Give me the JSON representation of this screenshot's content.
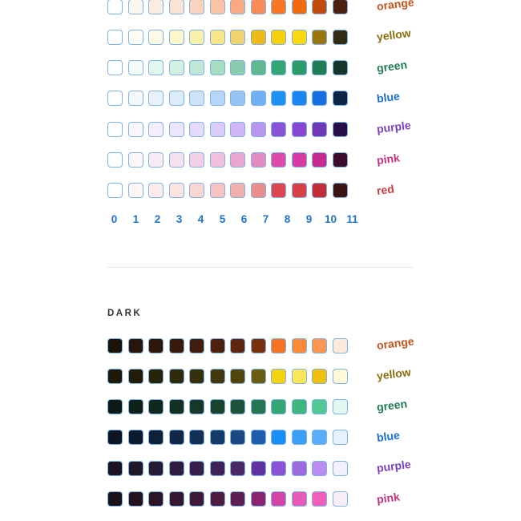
{
  "light": {
    "rows": [
      {
        "label": "orange",
        "label_color": "#c2561d",
        "swatches": [
          "#ffffff",
          "#fcf6f1",
          "#fbede2",
          "#fbe3d3",
          "#fbd4be",
          "#fbc3a3",
          "#fba982",
          "#f98c58",
          "#f87522",
          "#f26a10",
          "#c04c0c",
          "#4b200e"
        ]
      },
      {
        "label": "yellow",
        "label_color": "#8c6d0f",
        "swatches": [
          "#ffffff",
          "#fefdf4",
          "#fdfae3",
          "#fcf6c9",
          "#fbf0aa",
          "#f9e58a",
          "#f1d370",
          "#eeba16",
          "#f6d00f",
          "#fbd70f",
          "#9a760f",
          "#302b12"
        ]
      },
      {
        "label": "green",
        "label_color": "#1f7a4f",
        "swatches": [
          "#ffffff",
          "#f4fbf8",
          "#e3f6ee",
          "#d3f0e3",
          "#bfe7d5",
          "#a5dcc2",
          "#8ccbaf",
          "#5fb890",
          "#34a673",
          "#2b9b6a",
          "#207c55",
          "#143629"
        ]
      },
      {
        "label": "blue",
        "label_color": "#1a6fd4",
        "swatches": [
          "#ffffff",
          "#f4f8fd",
          "#e8f1fc",
          "#ddecfb",
          "#cce3fa",
          "#b5d6f8",
          "#95c4f5",
          "#6eb0f2",
          "#1f8ff3",
          "#1a86f2",
          "#176fe1",
          "#0c2445"
        ]
      },
      {
        "label": "purple",
        "label_color": "#7a3fbf",
        "swatches": [
          "#ffffff",
          "#f9f7fd",
          "#f2eefd",
          "#ede5fc",
          "#e5dafb",
          "#dbcbf8",
          "#cfb6f5",
          "#b995ee",
          "#8a52d4",
          "#8847d0",
          "#7038b6",
          "#280f4a"
        ]
      },
      {
        "label": "pink",
        "label_color": "#c0307d",
        "swatches": [
          "#ffffff",
          "#fcf5fa",
          "#f9ebf4",
          "#f6e0ee",
          "#f3d0e6",
          "#f0c1dd",
          "#eba6d0",
          "#e48ac2",
          "#dd4aa8",
          "#d73aa0",
          "#c62a8c",
          "#3d0c2c"
        ]
      },
      {
        "label": "red",
        "label_color": "#c93a40",
        "swatches": [
          "#ffffff",
          "#fdf6f5",
          "#fbeceb",
          "#fae4e2",
          "#f8d6d4",
          "#f5c4c2",
          "#f0aeac",
          "#ea8e8d",
          "#db4650",
          "#d84048",
          "#c32d36",
          "#3b1513"
        ]
      }
    ],
    "indices": [
      "0",
      "1",
      "2",
      "3",
      "4",
      "5",
      "6",
      "7",
      "8",
      "9",
      "10",
      "11"
    ]
  },
  "dark": {
    "title": "DARK",
    "rows": [
      {
        "label": "orange",
        "label_color": "#c2561d",
        "swatches": [
          "#1e1309",
          "#28150b",
          "#30170b",
          "#38190b",
          "#421c0d",
          "#4f200e",
          "#5e250f",
          "#7b310f",
          "#f57222",
          "#fb8a3b",
          "#fb9651",
          "#fbe9dc"
        ]
      },
      {
        "label": "yellow",
        "label_color": "#8c6d0f",
        "swatches": [
          "#1b1908",
          "#211d09",
          "#282409",
          "#2f2a0b",
          "#35300b",
          "#42380c",
          "#52440d",
          "#6b5d10",
          "#f5d20f",
          "#fbe85a",
          "#f0c00f",
          "#fdf8d8"
        ]
      },
      {
        "label": "green",
        "label_color": "#1f7a4f",
        "swatches": [
          "#0b1a14",
          "#0f2019",
          "#11281e",
          "#133023",
          "#163829",
          "#1a4331",
          "#1f523b",
          "#287554",
          "#34a673",
          "#3db77f",
          "#52c894",
          "#e2f7ee"
        ]
      },
      {
        "label": "blue",
        "label_color": "#1a6fd4",
        "swatches": [
          "#0b1523",
          "#0d1a2e",
          "#0f2039",
          "#112745",
          "#132f55",
          "#163a68",
          "#1a4882",
          "#1e5cac",
          "#1a8ff3",
          "#3a9ff5",
          "#58adf6",
          "#e6f2fd"
        ]
      },
      {
        "label": "purple",
        "label_color": "#7a3fbf",
        "swatches": [
          "#1a1421",
          "#201729",
          "#271a33",
          "#2e1d3d",
          "#361f48",
          "#3f2357",
          "#4b2969",
          "#6232a0",
          "#8a52d4",
          "#9d6ae0",
          "#b88cf0",
          "#f3effd"
        ]
      },
      {
        "label": "pink",
        "label_color": "#c0307d",
        "swatches": [
          "#1c111a",
          "#24131f",
          "#2c1526",
          "#35182d",
          "#3f1a36",
          "#4c1c41",
          "#5e1f50",
          "#8c2570",
          "#d446a6",
          "#e55bb5",
          "#f45fbc",
          "#fbedf6"
        ]
      }
    ]
  }
}
